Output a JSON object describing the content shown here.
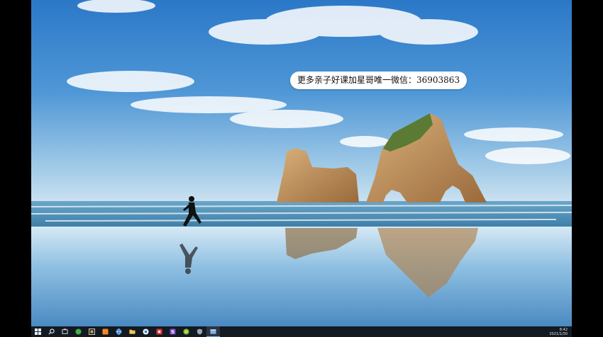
{
  "overlay": {
    "watermark_text": "更多亲子好课加星哥唯一微信：36903863"
  },
  "desktop": {
    "wallpaper": "beach with sea arches and runner reflection"
  },
  "taskbar": {
    "icons": [
      "windows-start-icon",
      "search-icon",
      "task-view-icon",
      "app-green-icon",
      "app-dark-icon",
      "app-orange-icon",
      "app-blue-globe-icon",
      "file-explorer-icon",
      "app-white-circle-icon",
      "app-red-icon",
      "app-purple-s-icon",
      "app-green-circle-icon",
      "app-shield-icon",
      "app-window-icon"
    ],
    "clock_time": "8:42",
    "clock_date": "2021/1/30"
  },
  "colors": {
    "sky_top": "#2f7fcf",
    "sky_bottom": "#bcd9ee",
    "sea": "#5f9fc4",
    "rock": "#c79a63",
    "taskbar": "#141a22"
  }
}
